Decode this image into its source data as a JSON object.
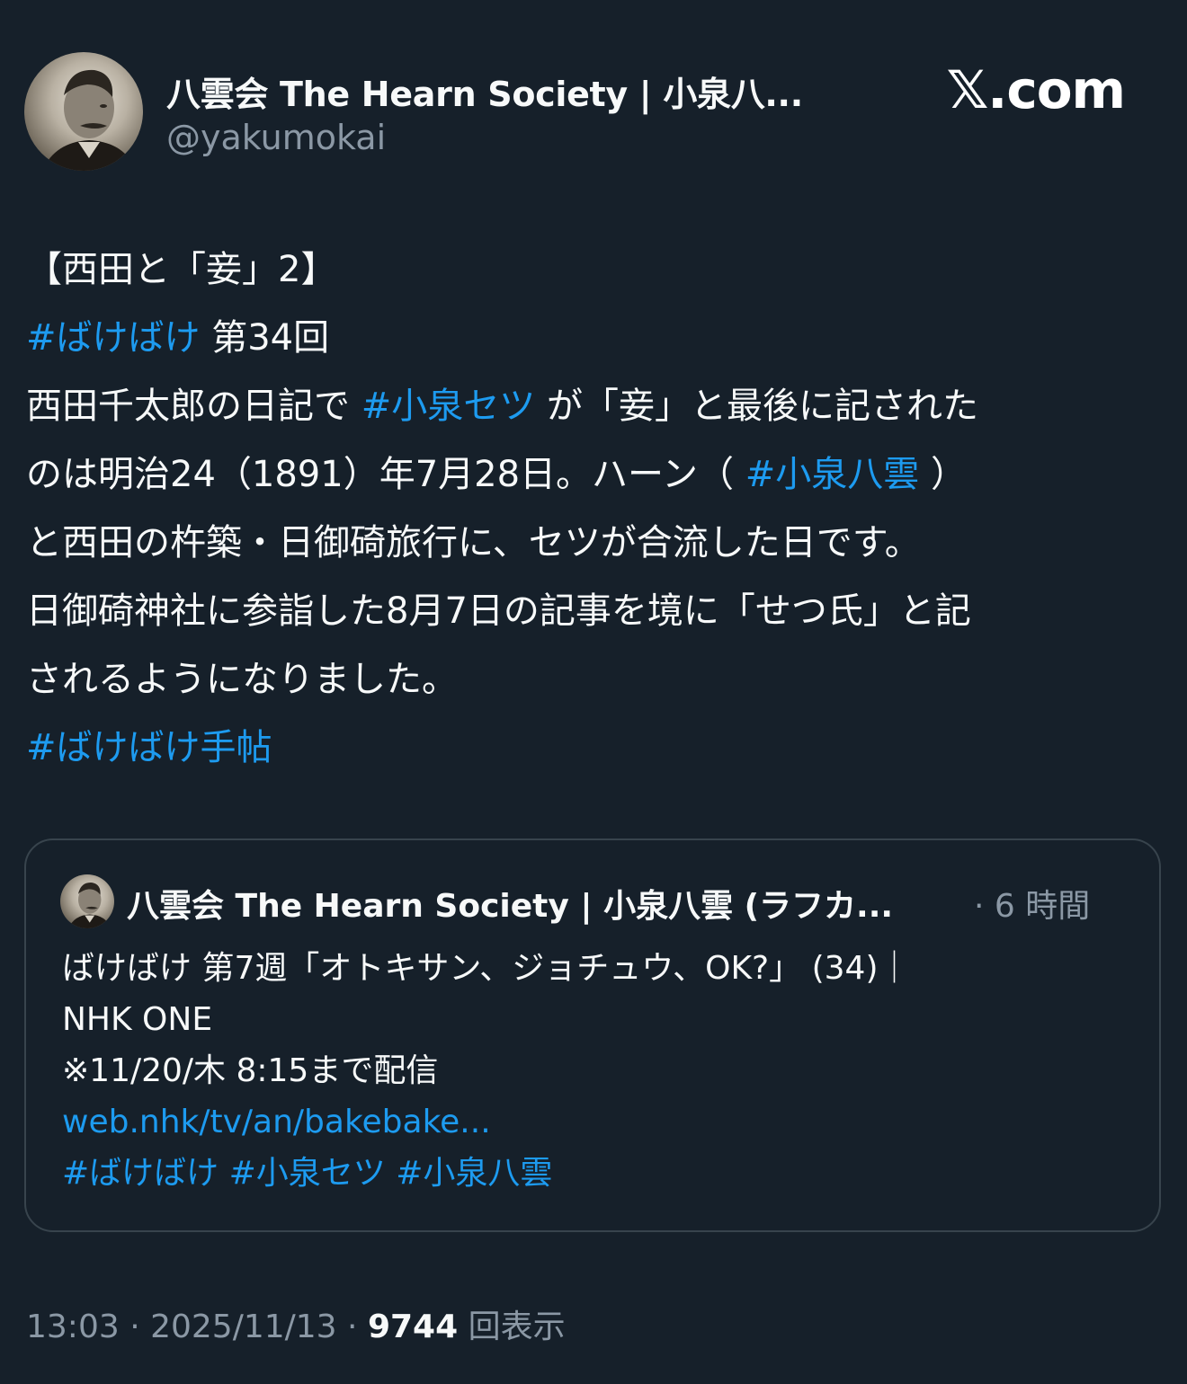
{
  "author": {
    "name": "八雲会 The Hearn Society | 小泉八...",
    "handle": "@yakumokai",
    "avatar_icon": "portrait-avatar-icon"
  },
  "brand": "𝕏.com",
  "tweet": {
    "line1": "【西田と「妾」2】",
    "line2_tag": "#ばけばけ",
    "line2_text": " 第34回",
    "line3_a": "西田千太郎の日記で ",
    "line3_tag": "#小泉セツ",
    "line3_b": " が「妾」と最後に記された",
    "line4_a": "のは明治24（1891）年7月28日。ハーン（ ",
    "line4_tag": "#小泉八雲",
    "line4_b": " ）",
    "line5": "と西田の杵築・日御碕旅行に、セツが合流した日です。",
    "line6": "日御碕神社に参詣した8月7日の記事を境に「せつ氏」と記",
    "line7": "されるようになりました。",
    "line8_tag": "#ばけばけ手帖"
  },
  "quote": {
    "author_name": "八雲会 The Hearn Society | 小泉八雲 (ラフカ...",
    "time": "· 6 時間",
    "line1": "ばけばけ 第7週「オトキサン、ジョチュウ、OK?」 (34)｜",
    "line2": "NHK ONE",
    "line3": "※11/20/木 8:15まで配信",
    "link": "web.nhk/tv/an/bakebake...",
    "tag1": "#ばけばけ",
    "tag2": "#小泉セツ",
    "tag3": "#小泉八雲"
  },
  "meta": {
    "time": "13:03",
    "date": "2025/11/13",
    "views_count": "9744",
    "views_label": "回表示"
  },
  "colors": {
    "background": "#16202a",
    "text": "#f7f9f9",
    "secondary": "#8b98a5",
    "link": "#1d9bf0",
    "border": "#38444d"
  }
}
